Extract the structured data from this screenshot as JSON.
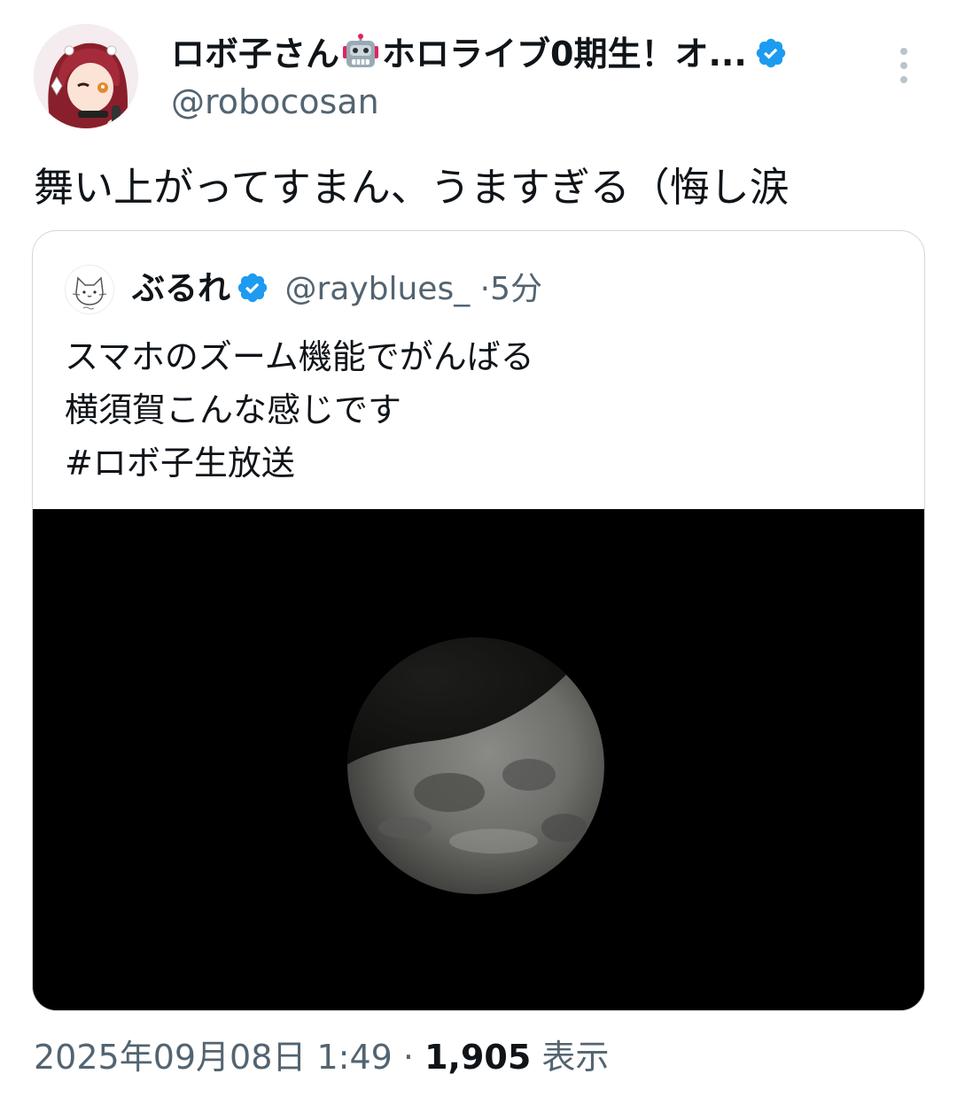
{
  "author": {
    "display_name_prefix": "ロボ子さん",
    "display_name_suffix": "ホロライブ0期生！オ...",
    "handle": "@robocosan",
    "verified_color": "#1d9bf0"
  },
  "tweet": {
    "text": "舞い上がってすまん、うますぎる（悔し涙"
  },
  "quote": {
    "author_name": "ぶるれ",
    "author_handle": "@rayblues_",
    "separator": "·",
    "time": "5分",
    "lines": [
      "スマホのズーム機能でがんばる",
      "横須賀こんな感じです",
      "#ロボ子生放送"
    ],
    "image_description_icon": "moon-image"
  },
  "footer": {
    "datetime": "2025年09月08日 1:49",
    "separator": "·",
    "views_count": "1,905",
    "views_label": "表示"
  },
  "colors": {
    "text_primary": "#0f1419",
    "text_secondary": "#536471",
    "border": "#cfd9de",
    "accent": "#1d9bf0"
  }
}
